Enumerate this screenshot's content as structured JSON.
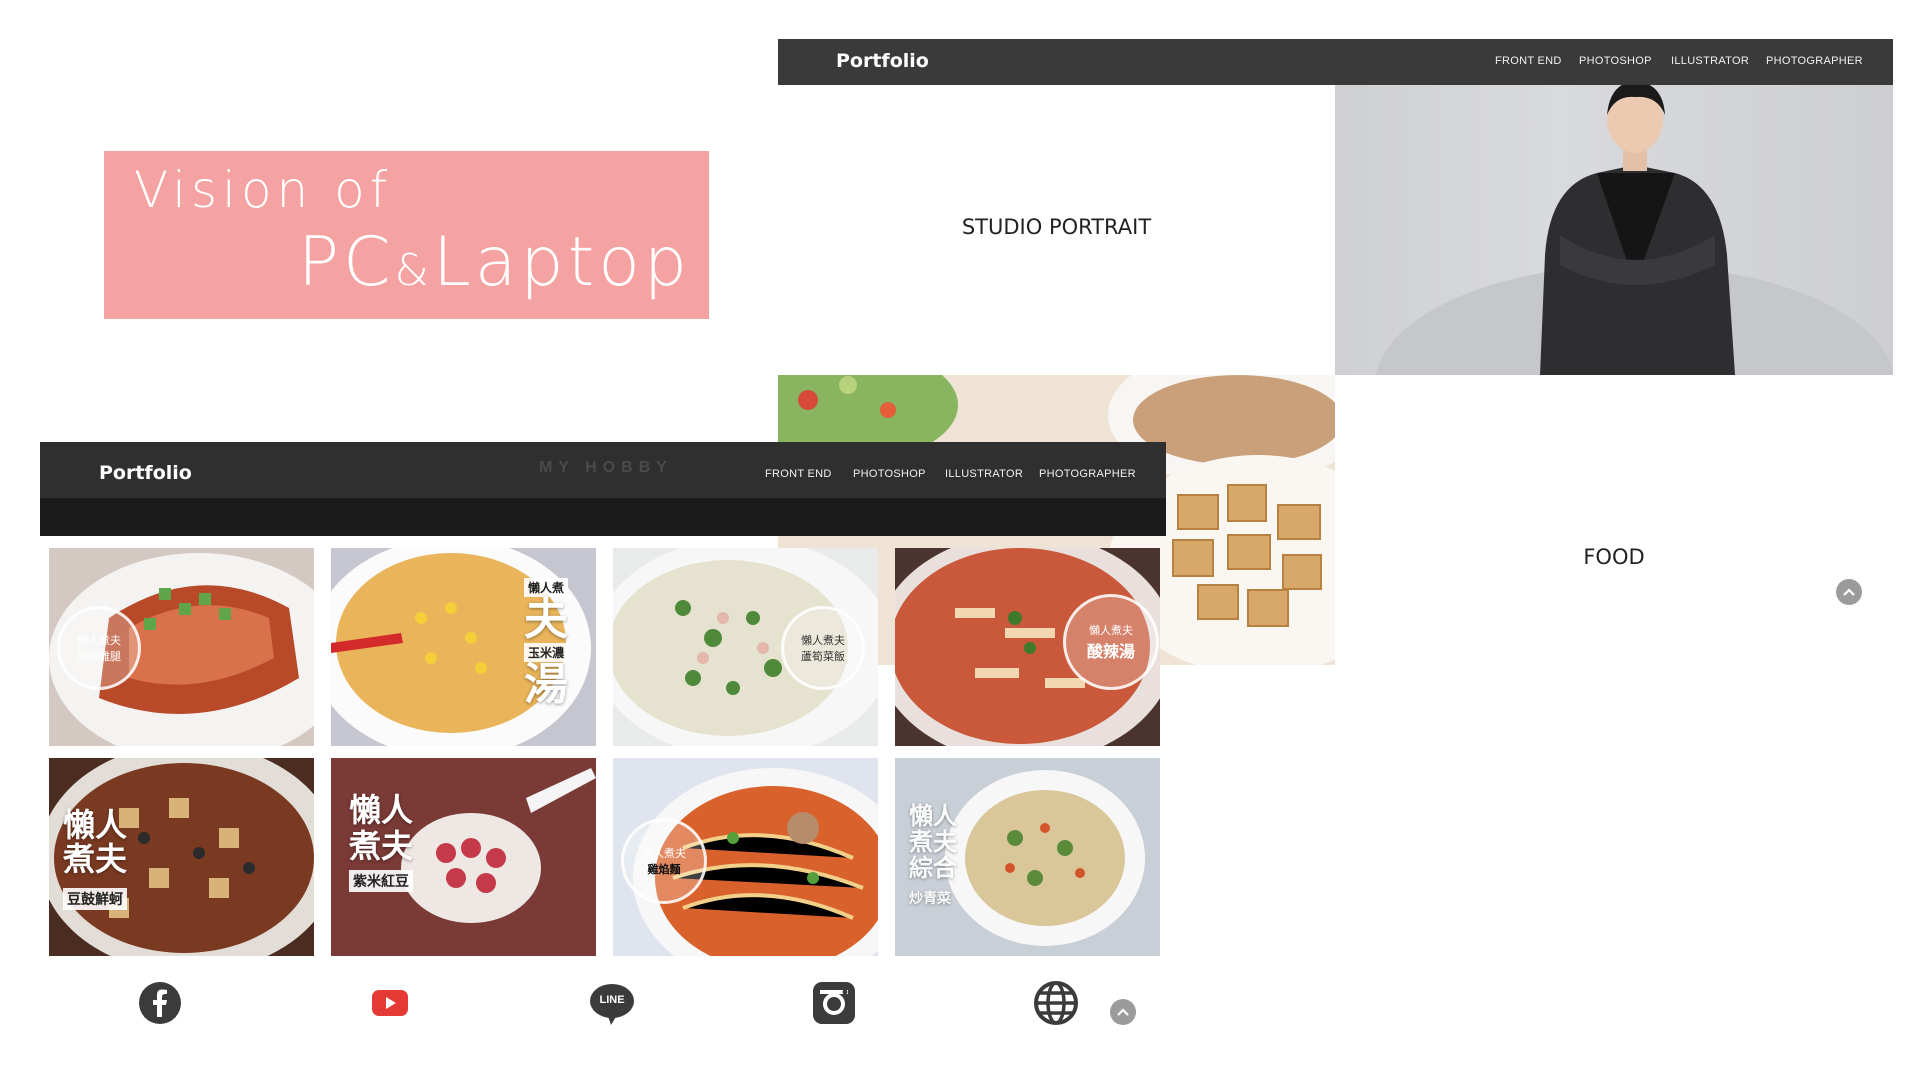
{
  "title_card": {
    "line1": "Vision of",
    "line2_a": "PC",
    "line2_amp": "&",
    "line2_b": "Laptop"
  },
  "right_window": {
    "brand": "Portfolio",
    "nav": [
      "FRONT END",
      "PHOTOSHOP",
      "ILLUSTRATOR",
      "PHOTOGRAPHER"
    ],
    "studio_label": "STUDIO PORTRAIT",
    "food_label": "FOOD"
  },
  "left_window": {
    "brand": "Portfolio",
    "subtitle": "MY HOBBY",
    "nav": [
      "FRONT END",
      "PHOTOSHOP",
      "ILLUSTRATOR",
      "PHOTOGRAPHER"
    ],
    "tiles": [
      {
        "top": "懶人煮夫",
        "bottom": "照燒雞腿"
      },
      {
        "top": "懶人煮",
        "big": "夫",
        "mid": "玉米濃",
        "big2": "湯"
      },
      {
        "top": "懶人煮夫",
        "bottom": "蘆筍菜飯"
      },
      {
        "top": "懶人煮夫",
        "bottom": "酸辣湯"
      },
      {
        "big": "懶人煮夫",
        "tag": "豆鼓鮮蚵"
      },
      {
        "big": "懶人煮夫",
        "tag": "紫米紅豆"
      },
      {
        "top": "懶人煮夫",
        "bottom": "雞焰麵"
      },
      {
        "big": "懶人煮夫綜合",
        "small": "炒青菜"
      }
    ],
    "social": [
      "facebook-icon",
      "youtube-icon",
      "line-icon",
      "instagram-icon",
      "globe-icon"
    ],
    "line_text": "LINE"
  },
  "colors": {
    "title_card": "#f5a2a2",
    "nav_bg": "#3a3a3a",
    "youtube": "#e53935"
  }
}
